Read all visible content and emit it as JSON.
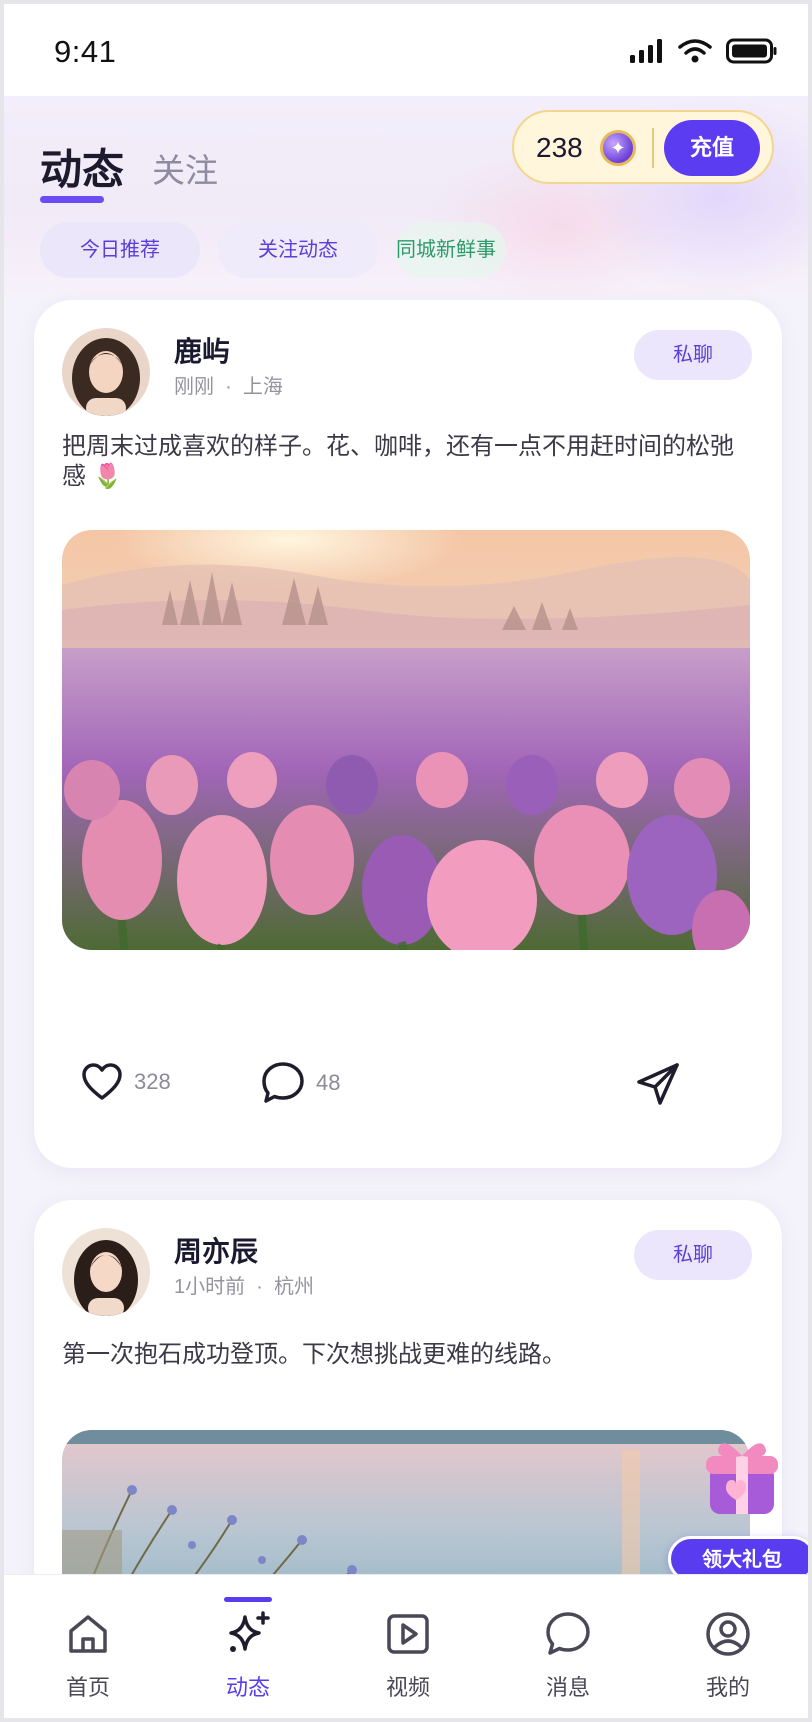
{
  "status_bar": {
    "time": "9:41"
  },
  "header": {
    "tab_active": "动态",
    "tab_secondary": "关注",
    "coins": "238",
    "recharge_label": "充值",
    "chips": [
      "今日推荐",
      "关注动态",
      "同城新鲜事"
    ]
  },
  "posts": [
    {
      "name": "鹿屿",
      "time": "刚刚",
      "location": "上海",
      "chat_label": "私聊",
      "text": "把周末过成喜欢的样子。花、咖啡，还有一点不用赶时间的松弛感 🌷",
      "likes": "328",
      "comments": "48"
    },
    {
      "name": "周亦辰",
      "time": "1小时前",
      "location": "杭州",
      "chat_label": "私聊",
      "text": "第一次抱石成功登顶。下次想挑战更难的线路。"
    }
  ],
  "gift": {
    "label": "领大礼包"
  },
  "tabbar": {
    "items": [
      {
        "label": "首页",
        "icon": "home-icon"
      },
      {
        "label": "动态",
        "icon": "sparkle-icon",
        "active": true
      },
      {
        "label": "视频",
        "icon": "video-icon"
      },
      {
        "label": "消息",
        "icon": "message-icon"
      },
      {
        "label": "我的",
        "icon": "profile-icon"
      }
    ]
  },
  "colors": {
    "accent": "#5a3cf0",
    "chip_green": "#2d9a6a",
    "coin_bg": "#fff6dc"
  }
}
